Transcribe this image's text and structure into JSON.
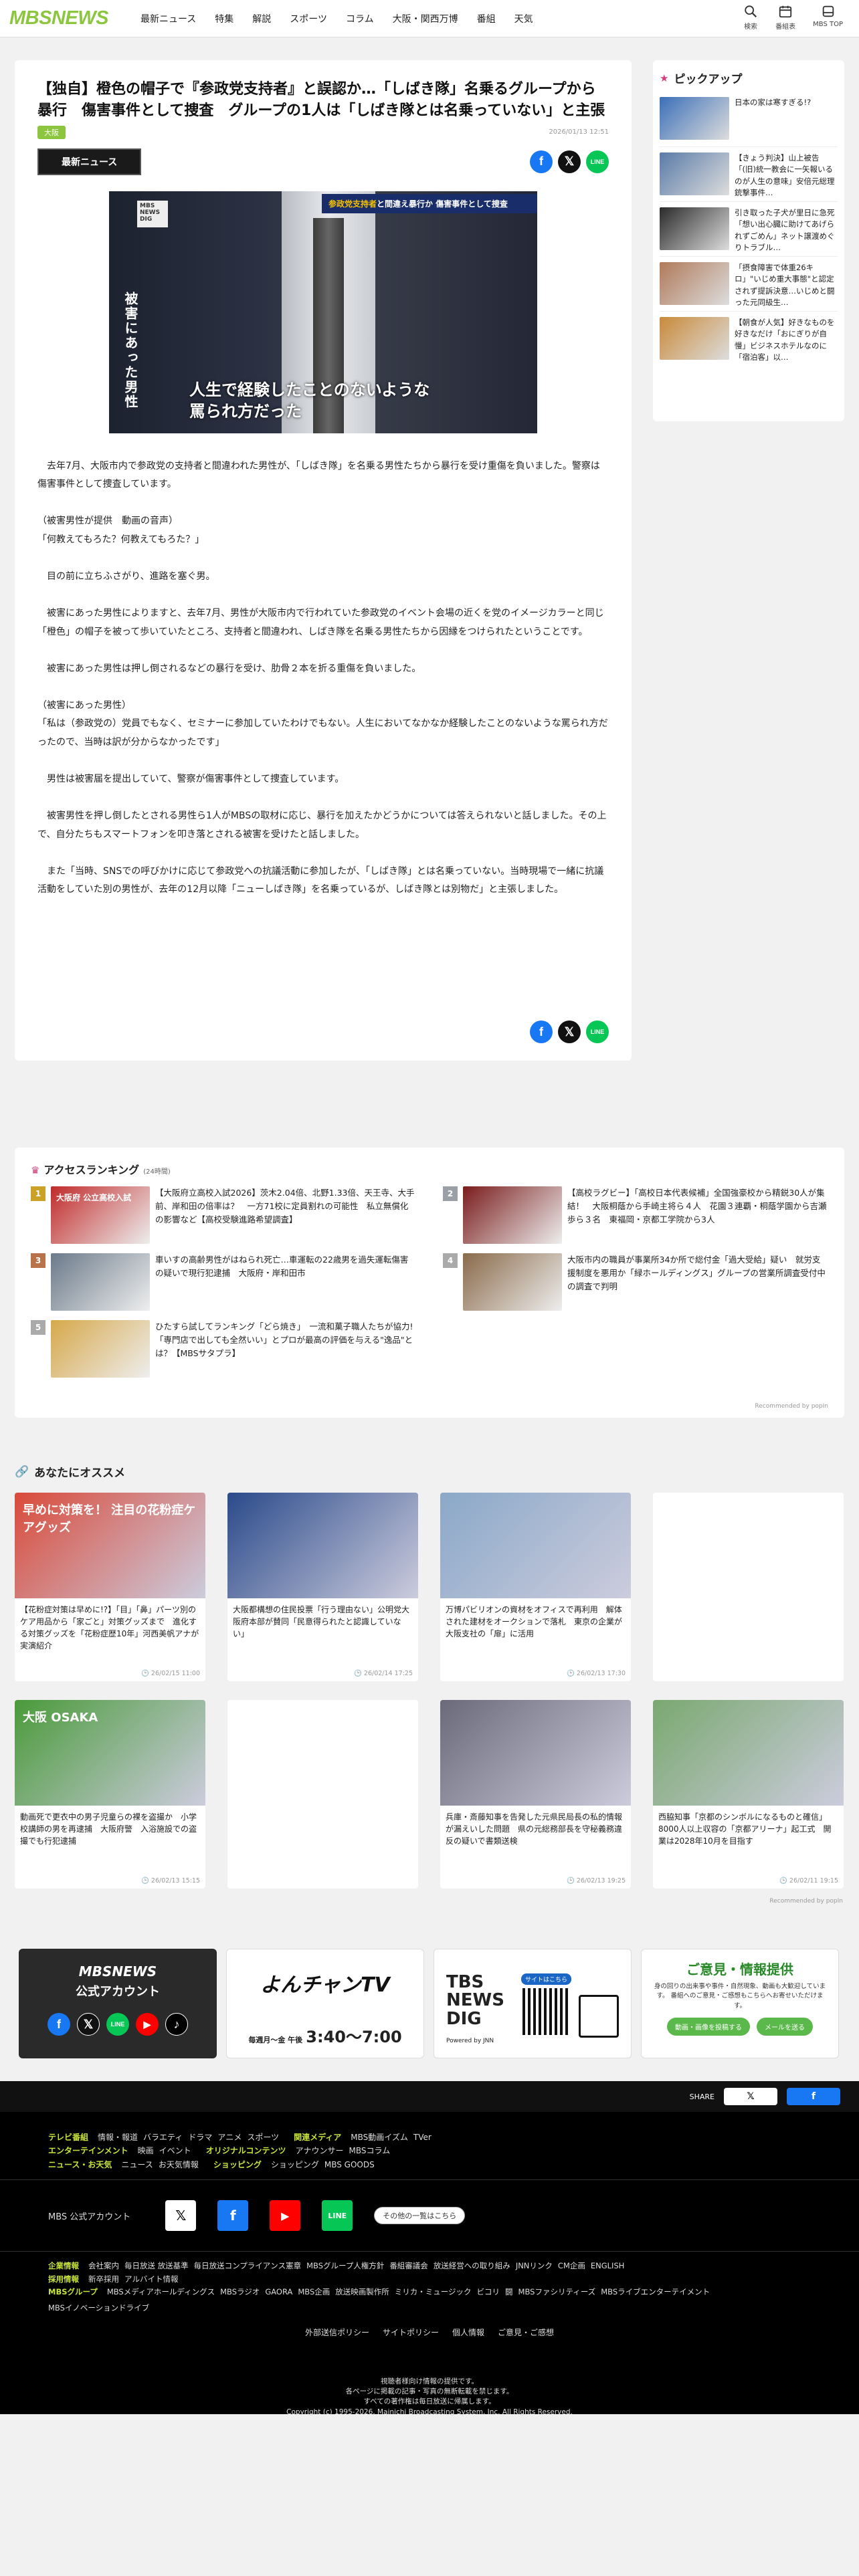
{
  "header": {
    "logo_mbs": "MBS",
    "logo_news": "NEWS",
    "nav": [
      "最新ニュース",
      "特集",
      "解説",
      "スポーツ",
      "コラム",
      "大阪・関西万博",
      "番組",
      "天気"
    ],
    "icons": [
      {
        "label": "検索",
        "icon": "search-icon"
      },
      {
        "label": "番組表",
        "icon": "calendar-icon"
      },
      {
        "label": "MBS TOP",
        "icon": "home-icon"
      }
    ]
  },
  "article": {
    "title": "【独自】橙色の帽子で『参政党支持者』と誤認か…「しばき隊」名乗るグループから暴行　傷害事件として捜査　グループの1人は「しばき隊とは名乗っていない」と主張",
    "tag": "大阪",
    "date": "2026/01/13 12:51",
    "program_label": "最新ニュース",
    "video": {
      "badge": "MBS NEWS DIG",
      "side_caption": "被害にあった男性",
      "top_caption_pre": "参政党支持者",
      "top_caption_post": "と間違え暴行か 傷害事件として捜査",
      "bottom_caption_l1": "人生で経験したことのないような",
      "bottom_caption_l2": "罵られ方だった"
    },
    "paragraphs": [
      "　去年7月、大阪市内で参政党の支持者と間違われた男性が、「しばき隊」を名乗る男性たちから暴行を受け重傷を負いました。警察は傷害事件として捜査しています。",
      "（被害男性が提供　動画の音声）",
      "「何教えてもろた？何教えてもろた？」",
      "　目の前に立ちふさがり、進路を塞ぐ男。",
      "　被害にあった男性によりますと、去年7月、男性が大阪市内で行われていた参政党のイベント会場の近くを党のイメージカラーと同じ「橙色」の帽子を被って歩いていたところ、支持者と間違われ、しばき隊を名乗る男性たちから因縁をつけられたということです。",
      "　被害にあった男性は押し倒されるなどの暴行を受け、肋骨２本を折る重傷を負いました。",
      "（被害にあった男性）",
      "「私は（参政党の）党員でもなく、セミナーに参加していたわけでもない。人生においてなかなか経験したことのないような罵られ方だったので、当時は訳が分からなかったです」",
      "　男性は被害届を提出していて、警察が傷害事件として捜査しています。",
      "　被害男性を押し倒したとされる男性ら1人がMBSの取材に応じ、暴行を加えたかどうかについては答えられないと話しました。その上で、自分たちもスマートフォンを叩き落とされる被害を受けたと話しました。",
      "　また「当時、SNSでの呼びかけに応じて参政党への抗議活動に参加したが、「しばき隊」とは名乗っていない。当時現場で一緒に抗議活動をしていた別の男性が、去年の12月以降「ニューしばき隊」を名乗っているが、しばき隊とは別物だ」と主張しました。"
    ]
  },
  "pickup": {
    "title": "ピックアップ",
    "items": [
      {
        "text": "日本の家は寒すぎる!?",
        "color": "#3b6fb8"
      },
      {
        "text": "【きょう判決】山上被告「(旧)統一教会に一矢報いるのが人生の意味」安倍元総理銃撃事件…",
        "color": "#5a7ba8"
      },
      {
        "text": "引き取った子犬が里日に急死「想い出心臓に助けてあげられずごめん」ネット譲渡めぐりトラブル…",
        "color": "#2a2a2a"
      },
      {
        "text": "「摂食障害で体重26キロ」\"いじめ重大事態\"と認定されず提訴決意…いじめと闘った元同級生…",
        "color": "#b07a5a"
      },
      {
        "text": "【朝食が人気】好きなものを好きなだけ「おにぎりが自慢」ビジネスホテルなのに「宿泊客」以…",
        "color": "#c98a3a"
      }
    ]
  },
  "ranking": {
    "title": "アクセスランキング",
    "period": "(24時間)",
    "credit": "Recommended by popIn",
    "items": [
      {
        "no": "1",
        "text": "【大阪府立高校入試2026】茨木2.04倍、北野1.33倍、天王寺、大手前、岸和田の倍率は？　一方71校に定員割れの可能性　私立無償化の影響など【高校受験進路希望調査】",
        "thumb_text": "大阪府 公立高校入試",
        "color": "#c12a2a"
      },
      {
        "no": "2",
        "text": "【高校ラグビー】「高校日本代表候補」全国強豪校から精鋭30人が集結！　大阪桐蔭から手崎主将ら４人　花園３連覇・桐蔭学園から吉瀬歩ら３名　東福岡・京都工学院から3人",
        "thumb_text": "",
        "color": "#7a1c1c"
      },
      {
        "no": "3",
        "text": "車いすの高齢男性がはねられ死亡…車運転の22歳男を過失運転傷害の疑いで現行犯逮捕　大阪府・岸和田市",
        "thumb_text": "",
        "color": "#6b7a8a"
      },
      {
        "no": "4",
        "text": "大阪市内の職員が事業所34か所で総付金「過大受給」疑い　就労支援制度を悪用か「緑ホールディングス」グループの営業所調査受付中の調査で判明",
        "thumb_text": "",
        "color": "#8a6a4a"
      },
      {
        "no": "5",
        "text": "ひたすら試してランキング「どら焼き」　一流和菓子職人たちが協力!「専門店で出しても全然いい」とプロが最高の評価を与える\"逸品\"とは？【MBSサタプラ】",
        "thumb_text": "",
        "color": "#d6a84a"
      }
    ]
  },
  "recommend": {
    "title": "あなたにオススメ",
    "credit": "Recommended by popIn",
    "cards": [
      {
        "text": "【花粉症対策は早めに!?】「目」「鼻」パーツ別のケア用品から「家ごと」対策グッズまで　進化する対策グッズを「花粉症歴10年」河西美帆アナが実演紹介",
        "date": "26/02/15 11:00",
        "color": "#d94a3a",
        "img_text": "早めに対策を！ 注目の花粉症ケアグッズ"
      },
      {
        "text": "大阪都構想の住民投票「行う理由ない」公明党大阪府本部が賛同「民意得られたと認識していない」",
        "date": "26/02/14 17:25",
        "color": "#2a4a8a",
        "img_text": ""
      },
      {
        "text": "万博パビリオンの資材をオフィスで再利用　解体された建材をオークションで落札　東京の企業が大阪支社の「扉」に活用",
        "date": "26/02/13 17:30",
        "color": "#8aa8c8",
        "img_text": ""
      },
      {
        "text": "",
        "date": "",
        "color": "#ffffff",
        "img_text": ""
      },
      {
        "text": "動画死で更衣中の男子児童らの裸を盗撮か　小学校講師の男を再逮捕　大阪府警　入浴施設での盗撮でも行犯逮捕",
        "date": "26/02/13 15:15",
        "color": "#4a9a3a",
        "img_text": "大阪 OSAKA"
      },
      {
        "text": "",
        "date": "",
        "color": "#ffffff",
        "img_text": ""
      },
      {
        "text": "兵庫・斎藤知事を告発した元県民局長の私的情報が漏えいした問題　県の元総務部長を守秘義務違反の疑いで書類送検",
        "date": "26/02/13 19:25",
        "color": "#6a6a7a",
        "img_text": ""
      },
      {
        "text": "西脇知事「京都のシンボルになるものと確信」　8000人以上収容の「京都アリーナ」起工式　開業は2028年10月を目指す",
        "date": "26/02/11 19:15",
        "color": "#7aa870",
        "img_text": ""
      }
    ]
  },
  "banners": {
    "b1_title": "MBSNEWS",
    "b1_sub": "公式アカウント",
    "b2_main": "よんチャンTV",
    "b2_time_pre": "毎週月～金 午後",
    "b2_time": "3:40〜7:00",
    "b3_title": "TBS NEWS DIG",
    "b3_sub": "Powered by JNN",
    "b3_qr": "サイトはこちら",
    "b4_title": "ご意見・情報提供",
    "b4_desc": "身の回りの出来事や事件・自然現象、動画も大歓迎しています。 番組へのご意見・ご感想もこちらへお寄せいただけます。",
    "b4_btn1": "動画・画像を投稿する",
    "b4_btn2": "メールを送る"
  },
  "footer": {
    "share_label": "SHARE",
    "rows": [
      {
        "head": "テレビ番組",
        "items": [
          "情報・報道",
          "バラエティ",
          "ドラマ",
          "アニメ",
          "スポーツ"
        ],
        "head2": "関連メディア",
        "items2": [
          "MBS動画イズム",
          "TVer"
        ]
      },
      {
        "head": "エンターテインメント",
        "items": [
          "映画",
          "イベント"
        ],
        "head2": "オリジナルコンテンツ",
        "items2": [
          "アナウンサー",
          "MBSコラム"
        ]
      },
      {
        "head": "ニュース・お天気",
        "items": [
          "ニュース",
          "お天気情報"
        ],
        "head2": "ショッピング",
        "items2": [
          "ショッピング",
          "MBS GOODS"
        ]
      }
    ],
    "accounts_label": "MBS 公式アカウント",
    "accounts_more": "その他の一覧はこちら",
    "corp_head": "企業情報",
    "corp_items": [
      "会社案内",
      "毎日放送 放送基準",
      "毎日放送コンプライアンス憲章",
      "MBSグループ人権方針",
      "番組審議会",
      "放送経営への取り組み",
      "JNNリンク",
      "CM企画",
      "ENGLISH"
    ],
    "recruit_head": "採用情報",
    "recruit_items": [
      "新卒採用",
      "アルバイト情報"
    ],
    "group_head": "MBSグループ",
    "group_items": [
      "MBSメディアホールディングス",
      "MBSラジオ",
      "GAORA",
      "MBS企画",
      "放送映画製作所",
      "ミリカ・ミュージック",
      "ビコリ",
      "闘",
      "MBSファシリティーズ",
      "MBSライブエンターテイメント",
      "MBSイノベーションドライブ"
    ],
    "bottom_links": [
      "外部送信ポリシー",
      "サイトポリシー",
      "個人情報",
      "ご意見・ご感想"
    ],
    "copy_l1": "視聴者様向け情報の提供です。",
    "copy_l2": "各ページに掲載の記事・写真の無断転載を禁じます。",
    "copy_l3": "すべての著作権は毎日放送に帰属します。",
    "copy_l4": "Copyright (c) 1995-2026, Mainichi Broadcasting System, Inc. All Rights Reserved."
  }
}
